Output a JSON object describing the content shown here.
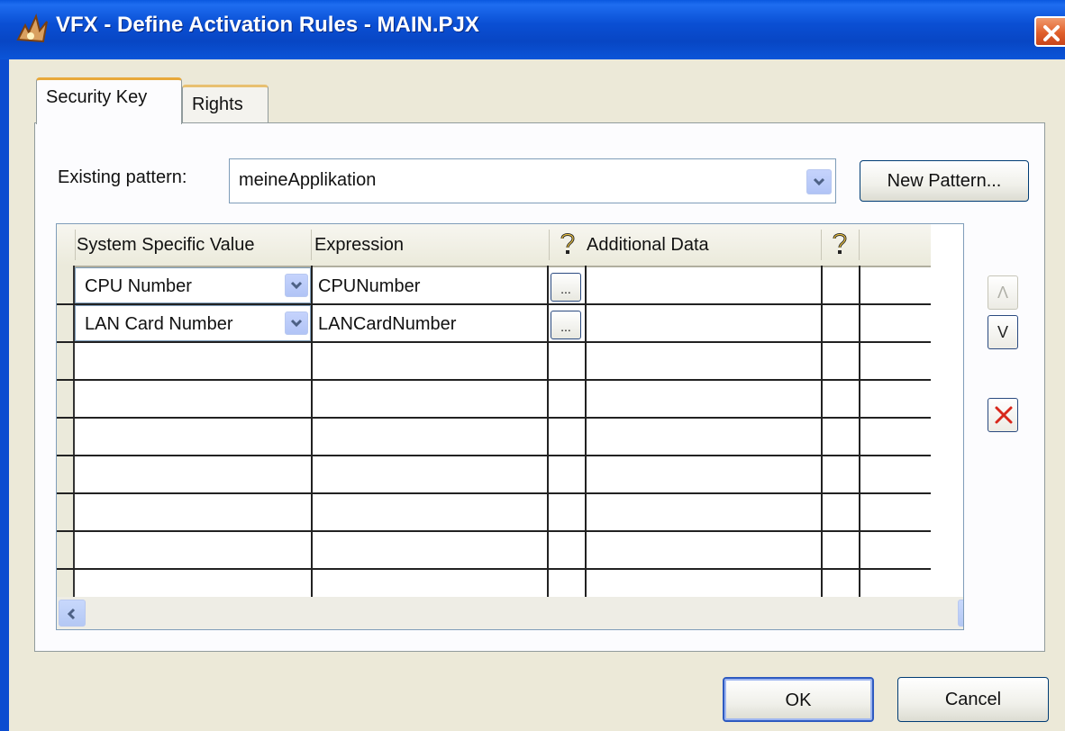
{
  "window": {
    "title": "VFX - Define Activation Rules - MAIN.PJX",
    "icon": "app-icon",
    "close_icon": "close-icon"
  },
  "tabs": [
    {
      "label": "Security Key",
      "active": true
    },
    {
      "label": "Rights",
      "active": false
    }
  ],
  "pattern": {
    "label": "Existing pattern:",
    "value": "meineApplikation",
    "new_button": "New Pattern..."
  },
  "grid": {
    "columns": [
      "System Specific Value",
      "Expression",
      "?",
      "Additional Data",
      "?"
    ],
    "help_icon": "question-mark-icon",
    "rows": [
      {
        "system_value": "CPU Number",
        "expression": "CPUNumber",
        "button": "...",
        "additional": ""
      },
      {
        "system_value": "LAN Card Number",
        "expression": "LANCardNumber",
        "button": "...",
        "additional": ""
      }
    ],
    "empty_rows": 7
  },
  "side_buttons": {
    "up": "Λ",
    "down": "V",
    "delete_icon": "delete-x-icon"
  },
  "footer": {
    "ok": "OK",
    "cancel": "Cancel"
  }
}
